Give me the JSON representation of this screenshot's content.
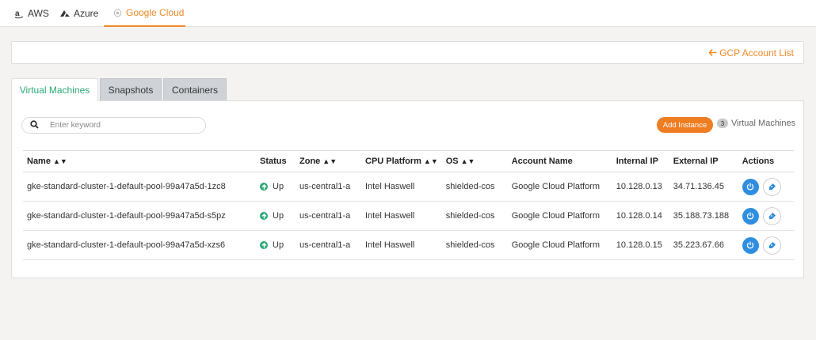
{
  "provider_tabs": [
    {
      "label": "AWS",
      "icon": "amazon-icon"
    },
    {
      "label": "Azure",
      "icon": "azure-icon"
    },
    {
      "label": "Google Cloud",
      "icon": "gcp-icon",
      "active": true
    }
  ],
  "account_bar": {
    "back_label": "GCP Account List",
    "back_icon": "arrow-left-icon"
  },
  "section_tabs": [
    {
      "label": "Virtual Machines",
      "active": true
    },
    {
      "label": "Snapshots"
    },
    {
      "label": "Containers"
    }
  ],
  "toolbar": {
    "search_placeholder": "Enter keyword",
    "add_label": "Add Instance",
    "count": "3",
    "count_label": "Virtual Machines"
  },
  "table": {
    "columns": [
      "Name",
      "Status",
      "Zone",
      "CPU Platform",
      "OS",
      "Account Name",
      "Internal IP",
      "External IP",
      "Actions"
    ],
    "rows": [
      {
        "name": "gke-standard-cluster-1-default-pool-99a47a5d-1zc8",
        "status": "Up",
        "zone": "us-central1-a",
        "cpu": "Intel Haswell",
        "os": "shielded-cos",
        "account": "Google Cloud Platform",
        "internal_ip": "10.128.0.13",
        "external_ip": "34.71.136.45"
      },
      {
        "name": "gke-standard-cluster-1-default-pool-99a47a5d-s5pz",
        "status": "Up",
        "zone": "us-central1-a",
        "cpu": "Intel Haswell",
        "os": "shielded-cos",
        "account": "Google Cloud Platform",
        "internal_ip": "10.128.0.14",
        "external_ip": "35.188.73.188"
      },
      {
        "name": "gke-standard-cluster-1-default-pool-99a47a5d-xzs6",
        "status": "Up",
        "zone": "us-central1-a",
        "cpu": "Intel Haswell",
        "os": "shielded-cos",
        "account": "Google Cloud Platform",
        "internal_ip": "10.128.0.15",
        "external_ip": "35.223.67.66"
      }
    ]
  },
  "colors": {
    "accent": "#ef8a28",
    "active_tab": "#2aa876",
    "status_up": "#2aa876",
    "power_button": "#2f8ee0"
  }
}
